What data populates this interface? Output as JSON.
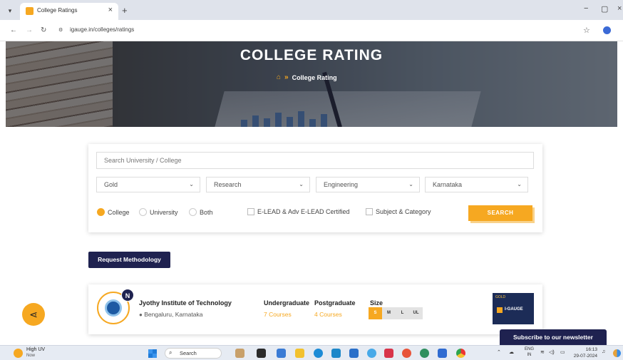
{
  "browser": {
    "tab_title": "College Ratings",
    "tab_close": "×",
    "new_tab": "+",
    "url": "igauge.in/colleges/ratings",
    "window_controls": [
      "−",
      "▢",
      "×"
    ]
  },
  "hero": {
    "title": "COLLEGE RATING",
    "breadcrumb_separator": "»",
    "breadcrumb_current": "College Rating"
  },
  "search": {
    "placeholder": "Search University / College",
    "filters": [
      {
        "value": "Gold"
      },
      {
        "value": "Research"
      },
      {
        "value": "Engineering"
      },
      {
        "value": "Karnataka"
      }
    ],
    "types": [
      {
        "label": "College",
        "selected": true
      },
      {
        "label": "University",
        "selected": false
      },
      {
        "label": "Both",
        "selected": false
      }
    ],
    "checkboxes": [
      {
        "label": "E-LEAD & Adv E-LEAD Certified",
        "checked": false
      },
      {
        "label": "Subject & Category",
        "checked": false
      }
    ],
    "button_label": "SEARCH"
  },
  "methodology_button": "Request Methodology",
  "college": {
    "badge_letter": "N",
    "name": "Jyothy Institute of Technology",
    "location": "Bengaluru, Karnataka",
    "undergraduate_label": "Undergraduate",
    "undergraduate_value": "7 Courses",
    "postgraduate_label": "Postgraduate",
    "postgraduate_value": "4 Courses",
    "size_label": "Size",
    "sizes": [
      {
        "label": "S",
        "active": true
      },
      {
        "label": "M",
        "active": false
      },
      {
        "label": "L",
        "active": false
      },
      {
        "label": "UL",
        "active": false
      }
    ],
    "rating_badge": {
      "tier": "GOLD",
      "brand": "I-GAUGE"
    }
  },
  "newsletter": "Subscribe to our newsletter",
  "taskbar": {
    "weather_title": "High UV",
    "weather_sub": "Now",
    "search_label": "Search",
    "lang_top": "ENG",
    "lang_bottom": "IN",
    "time": "16:13",
    "date": "29-07-2024"
  },
  "colors": {
    "accent": "#f6a821",
    "navy": "#1f2250"
  }
}
